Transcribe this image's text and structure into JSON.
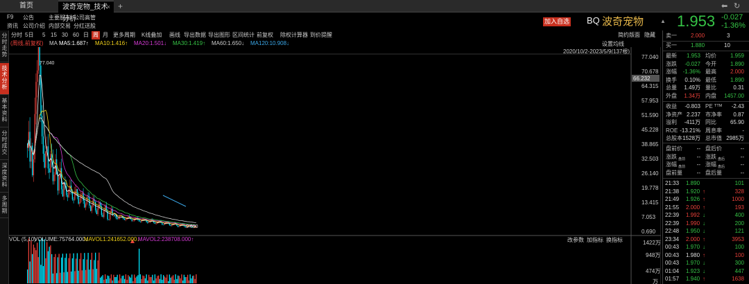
{
  "tabbar": {
    "home": "首页",
    "tab_title": "波奇宠物_技术分析",
    "close": "×",
    "plus": "+"
  },
  "nav": {
    "row1": [
      "F9",
      "公告",
      "主要股东",
      "公司高管"
    ],
    "row2": [
      "资讯",
      "公司介绍",
      "内部交易",
      "分红送股"
    ]
  },
  "header": {
    "add_watch": "加入自选",
    "code": "BQ",
    "name": "波奇宠物",
    "flag": "▲",
    "price": "1.953",
    "change": "-0.027",
    "change_pct": "-1.36%"
  },
  "sidebar": [
    {
      "label": "分时走势",
      "active": false
    },
    {
      "label": "技术分析",
      "active": true
    },
    {
      "label": "基本资料",
      "active": false
    },
    {
      "label": "分时成交",
      "active": false
    },
    {
      "label": "深度资料",
      "active": false
    },
    {
      "label": "多周期",
      "active": false
    }
  ],
  "toolbar": {
    "items": [
      "分时",
      "5日",
      "5",
      "15",
      "30",
      "60",
      "日",
      "周",
      "月",
      "更多周期",
      "K线叠加",
      "画线",
      "导出数据",
      "导出图形",
      "区间统计",
      "前复权",
      "除权计算器",
      "到价提醒"
    ],
    "active": "周",
    "right": [
      "简约版面",
      "隐藏"
    ]
  },
  "indicators": {
    "label": "(周线,前复权)",
    "ma": "MA",
    "ma5": "MA5:1.687↑",
    "ma10": "MA10:1.416↑",
    "ma20": "MA20:1.501↓",
    "ma30": "MA30:1.419↑",
    "ma60": "MA60:1.650↓",
    "ma120": "MA120:10.908↓",
    "settings": "设置均线",
    "date_range": "2020/10/2-2023/5/9(137根)"
  },
  "price_axis": {
    "labels": [
      "77.040",
      "70.678",
      "64.315",
      "57.953",
      "51.590",
      "45.228",
      "38.865",
      "32.503",
      "26.140",
      "19.778",
      "13.415",
      "7.053",
      "0.690"
    ],
    "highlight": "66.232",
    "high_label": "77.040",
    "low_label": "0.690"
  },
  "volume": {
    "title": "VOL (5,10)",
    "vol": "VOLUME:75764.000↓",
    "mavol1": "MAVOL1:241652.000↓",
    "mavol2": "MAVOL2:238708.000↑",
    "buttons": [
      "改参数",
      "加指标",
      "换指标"
    ],
    "axis": [
      "1422万",
      "948万",
      "474万",
      "万"
    ]
  },
  "orderbook": {
    "sell1": {
      "label": "卖一",
      "price": "2.000",
      "vol": "3"
    },
    "buy1": {
      "label": "买一",
      "price": "1.880",
      "vol": "10"
    }
  },
  "quote": [
    {
      "l1": "最新",
      "v1": "1.953",
      "c1": "g",
      "l2": "均价",
      "v2": "1.959",
      "c2": "g"
    },
    {
      "l1": "涨跌",
      "v1": "-0.027",
      "c1": "g",
      "l2": "今开",
      "v2": "1.890",
      "c2": "g"
    },
    {
      "l1": "涨幅",
      "v1": "-1.36%",
      "c1": "g",
      "l2": "最高",
      "v2": "2.000",
      "c2": "r"
    },
    {
      "l1": "换手",
      "v1": "0.10%",
      "c1": "w",
      "l2": "最低",
      "v2": "1.890",
      "c2": "g"
    },
    {
      "l1": "总量",
      "v1": "1.49万",
      "c1": "w",
      "l2": "量比",
      "v2": "0.31",
      "c2": "w"
    },
    {
      "l1": "外盘",
      "v1": "1.34万",
      "c1": "r",
      "l2": "内盘",
      "v2": "1457.00",
      "c2": "g"
    }
  ],
  "fundamentals": [
    {
      "l1": "收益",
      "v1": "-0.803",
      "l2": "PE ᵀᵀᴹ",
      "v2": "-2.43"
    },
    {
      "l1": "净资产",
      "v1": "2.237",
      "l2": "市净率",
      "v2": "0.87"
    },
    {
      "l1": "溢利",
      "v1": "-411万",
      "l2": "同比",
      "v2": "65.90"
    },
    {
      "l1": "ROE",
      "v1": "-13.21%",
      "l2": "周息率",
      "v2": "-"
    },
    {
      "l1": "总股本",
      "v1": "1528万",
      "l2": "总市值",
      "v2": "2985万"
    }
  ],
  "premarket": [
    {
      "l1": "盘前价",
      "v1": "--",
      "l2": "盘后价",
      "v2": "--"
    },
    {
      "l1": "涨跌",
      "sub1": "盘前",
      "v1": "--",
      "l2": "涨跌",
      "sub2": "盘后",
      "v2": "--"
    },
    {
      "l1": "涨幅",
      "sub1": "盘前",
      "v1": "--",
      "l2": "涨幅",
      "sub2": "盘后",
      "v2": "--"
    },
    {
      "l1": "盘前量",
      "v1": "--",
      "l2": "盘后量",
      "v2": "--"
    }
  ],
  "ticks": [
    {
      "time": "21:33",
      "price": "1.890",
      "pc": "g",
      "arrow": "",
      "vol": "101",
      "vc": "g"
    },
    {
      "time": "21:38",
      "price": "1.920",
      "pc": "g",
      "arrow": "↑",
      "vol": "328",
      "vc": "r"
    },
    {
      "time": "21:49",
      "price": "1.926",
      "pc": "g",
      "arrow": "↑",
      "vol": "1000",
      "vc": "r"
    },
    {
      "time": "21:55",
      "price": "2.000",
      "pc": "r",
      "arrow": "↑",
      "vol": "193",
      "vc": "r"
    },
    {
      "time": "22:39",
      "price": "1.992",
      "pc": "r",
      "arrow": "↓",
      "vol": "400",
      "vc": "g"
    },
    {
      "time": "22:39",
      "price": "1.990",
      "pc": "r",
      "arrow": "↓",
      "vol": "200",
      "vc": "g"
    },
    {
      "time": "22:48",
      "price": "1.950",
      "pc": "g",
      "arrow": "↓",
      "vol": "121",
      "vc": "g"
    },
    {
      "time": "23:34",
      "price": "2.000",
      "pc": "r",
      "arrow": "↑",
      "vol": "3953",
      "vc": "r"
    },
    {
      "time": "00:43",
      "price": "1.970",
      "pc": "g",
      "arrow": "↓",
      "vol": "100",
      "vc": "g"
    },
    {
      "time": "00:43",
      "price": "1.980",
      "pc": "w",
      "arrow": "↑",
      "vol": "100",
      "vc": "r"
    },
    {
      "time": "00:43",
      "price": "1.970",
      "pc": "g",
      "arrow": "↓",
      "vol": "300",
      "vc": "g"
    },
    {
      "time": "01:04",
      "price": "1.923",
      "pc": "g",
      "arrow": "↓",
      "vol": "447",
      "vc": "g"
    },
    {
      "time": "01:57",
      "price": "1.940",
      "pc": "g",
      "arrow": "↑",
      "vol": "1638",
      "vc": "r"
    }
  ],
  "colors": {
    "up": "#e8413a",
    "down": "#36c346",
    "ma5": "#ffffff",
    "ma10": "#f2d21b",
    "ma20": "#d63bd6",
    "ma30": "#36c346",
    "ma60": "#ffffff",
    "ma120": "#3ba7e8",
    "accent": "#c8301f"
  }
}
